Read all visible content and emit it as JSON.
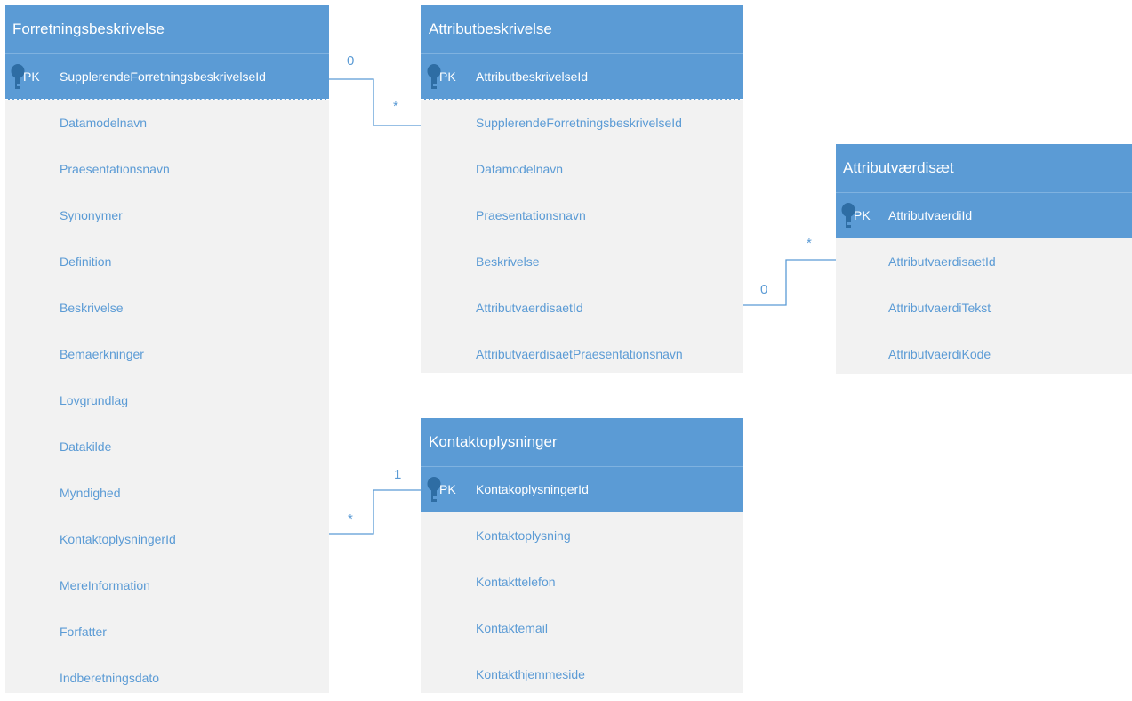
{
  "entities": {
    "forretningsbeskrivelse": {
      "title": "Forretningsbeskrivelse",
      "pk_label": "PK",
      "pk_field": "SupplerendeForretningsbeskrivelseId",
      "fields": [
        "Datamodelnavn",
        "Praesentationsnavn",
        "Synonymer",
        "Definition",
        "Beskrivelse",
        "Bemaerkninger",
        "Lovgrundlag",
        "Datakilde",
        "Myndighed",
        "KontaktoplysningerId",
        "MereInformation",
        "Forfatter",
        "Indberetningsdato"
      ]
    },
    "attributbeskrivelse": {
      "title": "Attributbeskrivelse",
      "pk_label": "PK",
      "pk_field": "AttributbeskrivelseId",
      "fields": [
        "SupplerendeForretningsbeskrivelseId",
        "Datamodelnavn",
        "Praesentationsnavn",
        "Beskrivelse",
        "AttributvaerdisaetId",
        "AttributvaerdisaetPraesentationsnavn"
      ]
    },
    "attributvaerdisaet": {
      "title": "Attributværdisæt",
      "pk_label": "PK",
      "pk_field": "AttributvaerdiId",
      "fields": [
        "AttributvaerdisaetId",
        "AttributvaerdiTekst",
        "AttributvaerdiKode"
      ]
    },
    "kontaktoplysninger": {
      "title": "Kontaktoplysninger",
      "pk_label": "PK",
      "pk_field": "KontakoplysningerId",
      "fields": [
        "Kontaktoplysning",
        "Kontakttelefon",
        "Kontaktemail",
        "Kontakthjemmeside"
      ]
    }
  },
  "relations": {
    "forretning_attribut": {
      "from_mult": "0",
      "to_mult": "*"
    },
    "attribut_vaerdisaet": {
      "from_mult": "0",
      "to_mult": "*"
    },
    "forretning_kontakt": {
      "from_mult": "*",
      "to_mult": "1"
    }
  },
  "colors": {
    "header": "#5b9bd5",
    "body": "#f2f2f2",
    "text": "#5b9bd5",
    "line": "#5b9bd5"
  }
}
